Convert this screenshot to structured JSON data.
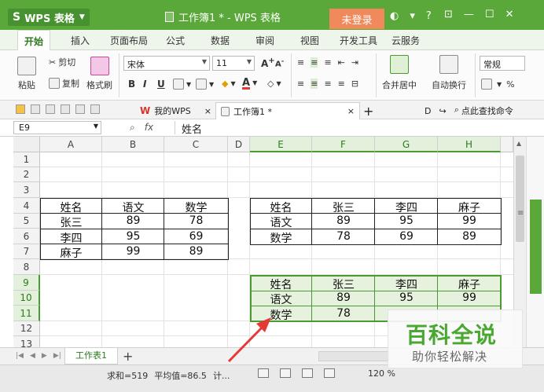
{
  "app": {
    "name": "WPS 表格",
    "logo": "S",
    "doc_title": "工作簿1 * - WPS 表格",
    "login_label": "未登录"
  },
  "title_icons": [
    "skin-icon",
    "shirt-icon",
    "help-icon"
  ],
  "menu": {
    "tabs": [
      "开始",
      "插入",
      "页面布局",
      "公式",
      "数据",
      "审阅",
      "视图",
      "开发工具",
      "云服务"
    ]
  },
  "ribbon": {
    "paste": "粘贴",
    "cut": "剪切",
    "copy": "复制",
    "format_painter": "格式刷",
    "font_name": "宋体",
    "font_size": "11",
    "bold": "B",
    "italic": "I",
    "underline": "U",
    "merge_center": "合并居中",
    "auto_wrap": "自动换行",
    "number_format": "常规",
    "percent": "%",
    "grow_font": "A",
    "shrink_font": "A",
    "font_color": "A"
  },
  "doc_tabs": {
    "my_wps": "我的WPS",
    "workbook": "工作簿1 *",
    "search_label": "点此查找命令"
  },
  "formula_bar": {
    "cell_ref": "E9",
    "fx": "fx",
    "content": "姓名"
  },
  "sheet": {
    "columns": [
      "A",
      "B",
      "C",
      "D",
      "E",
      "F",
      "G",
      "H"
    ],
    "rows": [
      "1",
      "2",
      "3",
      "4",
      "5",
      "6",
      "7",
      "8",
      "9",
      "10",
      "11",
      "12",
      "13"
    ],
    "table1": {
      "header": [
        "姓名",
        "语文",
        "数学"
      ],
      "rows": [
        [
          "张三",
          "89",
          "78"
        ],
        [
          "李四",
          "95",
          "69"
        ],
        [
          "麻子",
          "99",
          "89"
        ]
      ]
    },
    "table2": {
      "header": [
        "姓名",
        "张三",
        "李四",
        "麻子"
      ],
      "rows": [
        [
          "语文",
          "89",
          "95",
          "99"
        ],
        [
          "数学",
          "78",
          "69",
          "89"
        ]
      ]
    },
    "table3": {
      "header": [
        "姓名",
        "张三",
        "李四",
        "麻子"
      ],
      "rows": [
        [
          "语文",
          "89",
          "95",
          "99"
        ],
        [
          "数学",
          "78",
          "",
          ""
        ]
      ]
    }
  },
  "sheet_tabs": {
    "active": "工作表1",
    "add": "+"
  },
  "status": {
    "sum": "求和=519",
    "avg": "平均值=86.5",
    "count": "计...",
    "zoom": "120 %"
  },
  "watermark": {
    "main": "百科全说",
    "sub": "助你轻松解决"
  },
  "colors": {
    "accent": "#5aa83a",
    "selection": "#e6f2de",
    "login": "#f08a5d",
    "arrow": "#e53935"
  }
}
